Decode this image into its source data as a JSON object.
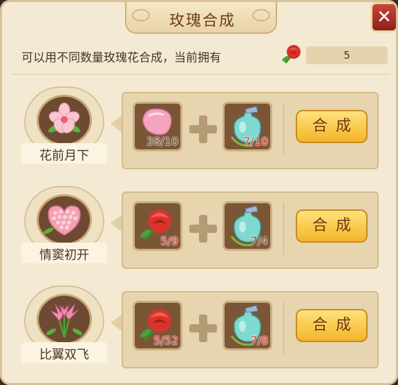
{
  "title": "玫瑰合成",
  "close_icon": "close-icon",
  "info": {
    "text": "可以用不同数量玫瑰花合成，当前拥有",
    "rose_count": "5"
  },
  "recipes": [
    {
      "name": "花前月下",
      "item_a_count": "38/10",
      "item_b_count": "7/10",
      "button": "合成"
    },
    {
      "name": "情窦初开",
      "item_a_count": "5/9",
      "item_b_count": "7/4",
      "button": "合成"
    },
    {
      "name": "比翼双飞",
      "item_a_count": "5/52",
      "item_b_count": "7/8",
      "button": "合成"
    }
  ],
  "colors": {
    "panel": "#f4ead3",
    "button": "#f3b52a",
    "insufficient": "#e3443a"
  }
}
